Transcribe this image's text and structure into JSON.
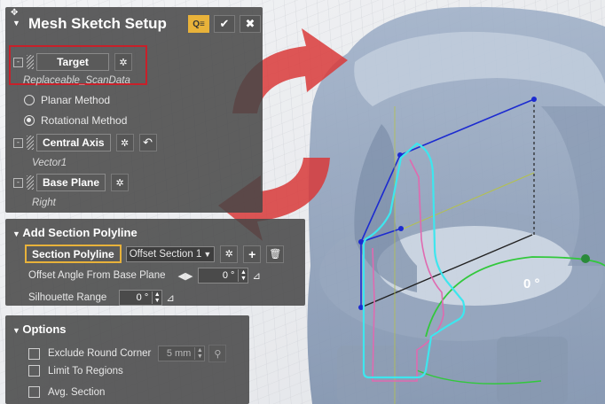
{
  "header": {
    "title": "Mesh Sketch Setup"
  },
  "setup": {
    "target_label": "Target",
    "target_value": "Replaceable_ScanData",
    "planar_label": "Planar Method",
    "rotational_label": "Rotational Method",
    "selected_method": "Rotational Method",
    "axis_label": "Central Axis",
    "axis_value": "Vector1",
    "plane_label": "Base Plane",
    "plane_value": "Right"
  },
  "section": {
    "title": "Add Section Polyline",
    "polyline_button": "Section Polyline",
    "offset_dropdown": "Offset Section 1",
    "offset_angle_label": "Offset Angle From Base Plane",
    "offset_angle_value": "0 °",
    "silhouette_label": "Silhouette Range",
    "silhouette_value": "0 °"
  },
  "options": {
    "title": "Options",
    "exclude_label": "Exclude Round Corner",
    "exclude_value": "5 mm",
    "limit_label": "Limit To Regions",
    "avg_label": "Avg. Section"
  },
  "viewport": {
    "angle_label": "0 °"
  },
  "colors": {
    "highlight_red": "#c8202a",
    "accent_orange": "#e8b23a",
    "polyline_cyan": "#3ee6ee"
  }
}
